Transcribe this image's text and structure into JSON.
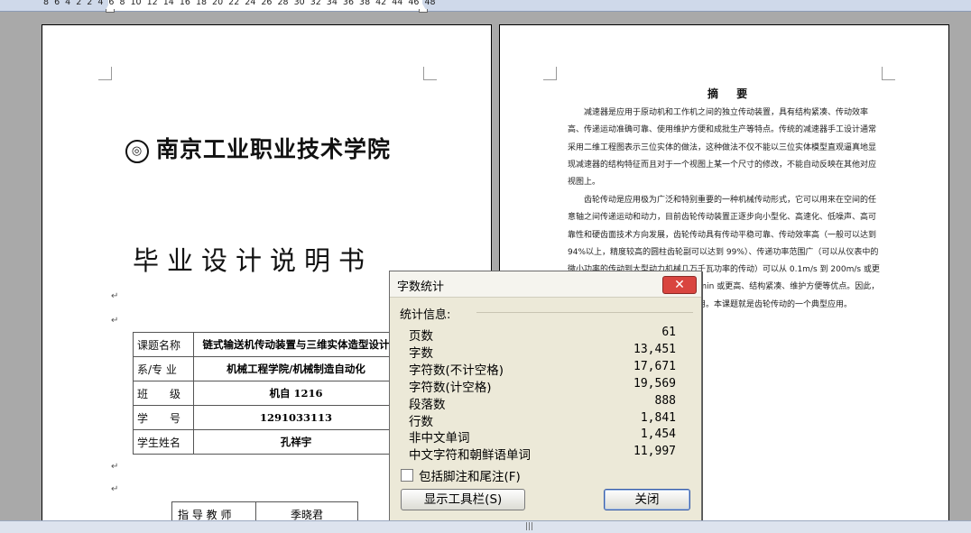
{
  "ruler": {
    "numbers": "8  6  4  2     2  4  6  8  10  12  14  16  18  20  22  24  26  28  30  32  34  36  38     42  44  46  48"
  },
  "left_page": {
    "logo_text": "南京工业职业技术学院",
    "logo_seal": "◎",
    "title": "毕业设计说明书",
    "para_mark": "↵",
    "table": [
      {
        "label": "课题名称",
        "value": "链式输送机传动装置与三维实体造型设计"
      },
      {
        "label": "系/专 业",
        "value": "机械工程学院/机械制造自动化"
      },
      {
        "label": "班　　级",
        "value": "机自 1216"
      },
      {
        "label": "学　　号",
        "value": "1291033113"
      },
      {
        "label": "学生姓名",
        "value": "孔祥宇"
      }
    ],
    "advisor_label": "指 导 教 师",
    "advisor_value": "季晓君"
  },
  "right_page": {
    "heading": "摘 要",
    "paragraphs": [
      "减速器是应用于原动机和工作机之间的独立传动装置，具有结构紧凑、传动效率高、传递运动准确可靠、使用维护方便和成批生产等特点。传统的减速器手工设计通常采用二维工程图表示三位实体的做法，这种做法不仅不能以三位实体模型直观逼真地显现减速器的结构特征而且对于一个视图上某一个尺寸的修改，不能自动反映在其他对应视图上。",
      "齿轮传动是应用极为广泛和特别重要的一种机械传动形式，它可以用来在空间的任意轴之间传递运动和动力，目前齿轮传动装置正逐步向小型化、高速化、低噪声、高可靠性和硬齿面技术方向发展，齿轮传动具有传动平稳可靠、传动效率高（一般可以达到 94%以上，精度较高的圆柱齿轮副可以达到 99%）、传递功率范围广（可以从仪表中的微小功率的传动到大型动力机械几万千瓦功率的传动）可以从 0.1m/s 到 200m/s 或更高，转速可以从 1r/min 到 20000r/min 或更高、结构紧凑、维护方便等优点。因此，它在各种机械设备和仪表中被广泛使用。本课题就是齿轮传动的一个典型应用。"
    ]
  },
  "dialog": {
    "title": "字数统计",
    "close_glyph": "✕",
    "stats_heading": "统计信息:",
    "rows": [
      {
        "label": "页数",
        "value": "61"
      },
      {
        "label": "字数",
        "value": "13,451"
      },
      {
        "label": "字符数(不计空格)",
        "value": "17,671"
      },
      {
        "label": "字符数(计空格)",
        "value": "19,569"
      },
      {
        "label": "段落数",
        "value": "888"
      },
      {
        "label": "行数",
        "value": "1,841"
      },
      {
        "label": "非中文单词",
        "value": "1,454"
      },
      {
        "label": "中文字符和朝鲜语单词",
        "value": "11,997"
      }
    ],
    "checkbox_label": "包括脚注和尾注(F)",
    "checkbox_checked": false,
    "toolbar_button": "显示工具栏(S)",
    "close_button": "关闭"
  },
  "statusbar": {
    "grip": "|||"
  }
}
